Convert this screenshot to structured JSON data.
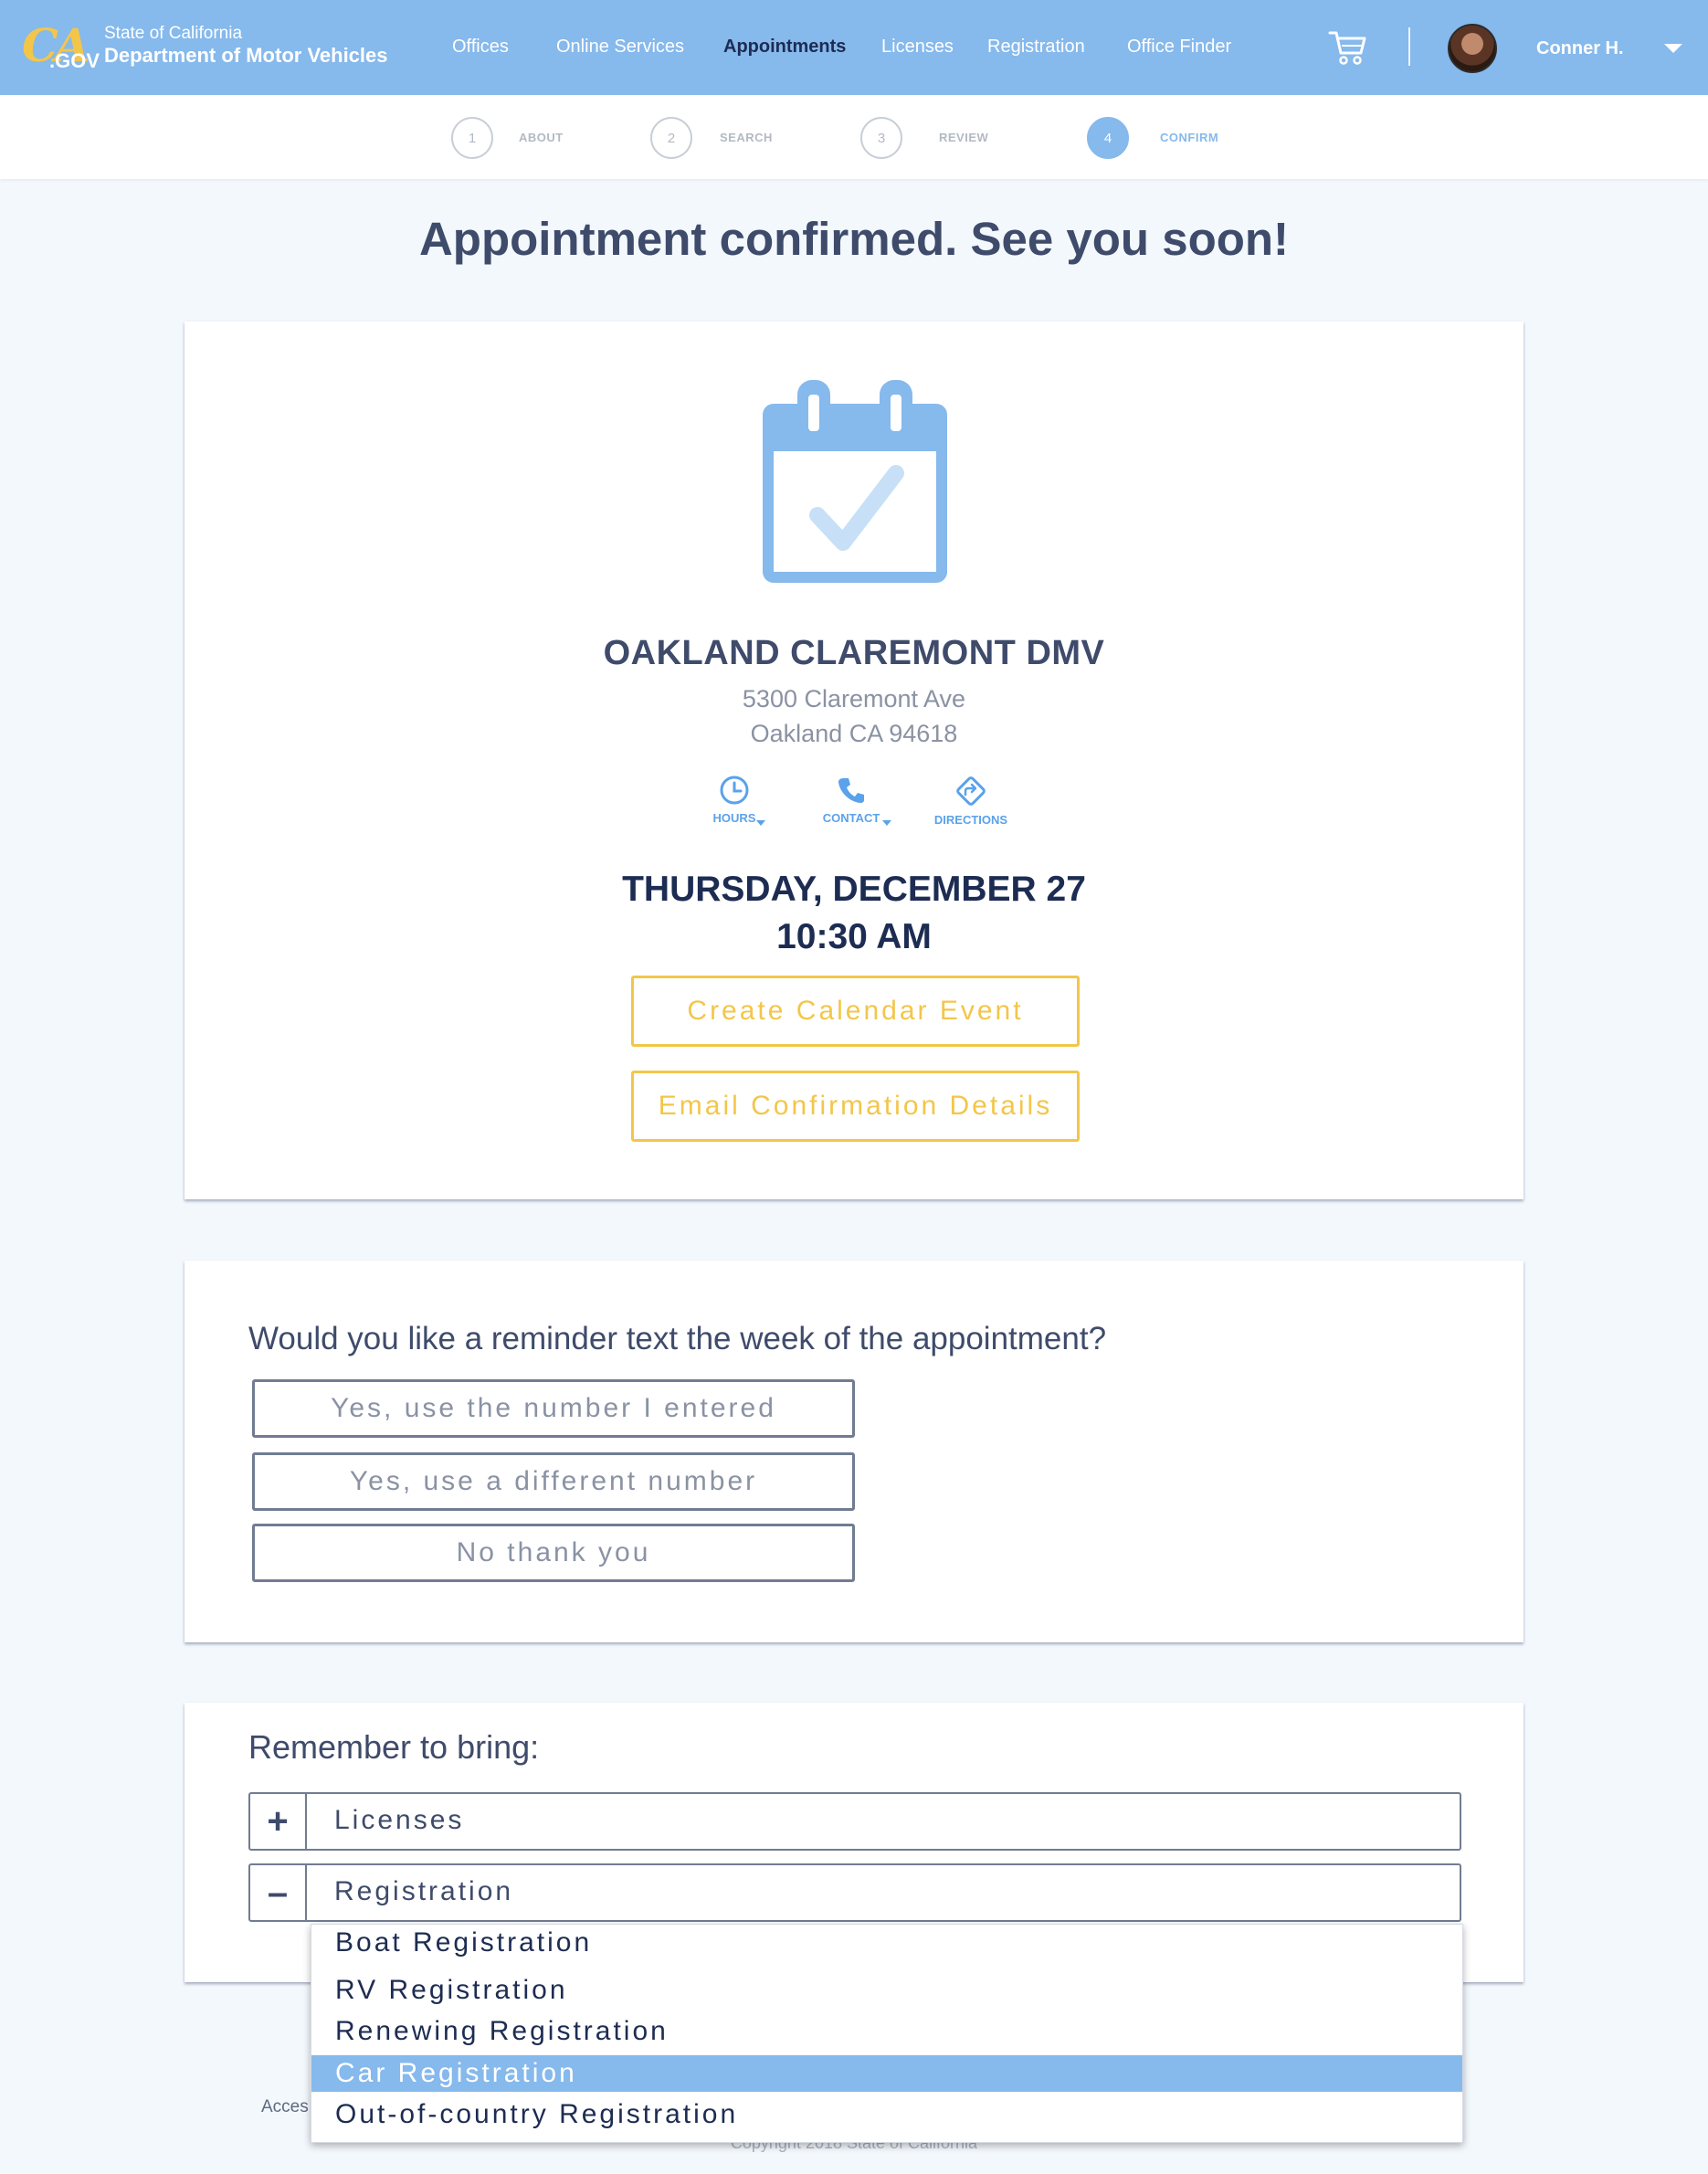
{
  "header": {
    "logo_ca": "CA",
    "logo_gov": ".GOV",
    "agency_top": "State of California",
    "agency_name": "Department of Motor Vehicles",
    "nav": [
      {
        "label": "Offices",
        "active": false
      },
      {
        "label": "Online Services",
        "active": false
      },
      {
        "label": "Appointments",
        "active": true
      },
      {
        "label": "Licenses",
        "active": false
      },
      {
        "label": "Registration",
        "active": false
      },
      {
        "label": "Office Finder",
        "active": false
      }
    ],
    "user_name": "Conner H.",
    "icons": {
      "cart": "cart-icon",
      "caret": "chevron-down-icon"
    }
  },
  "stepper": {
    "steps": [
      {
        "number": "1",
        "label": "ABOUT",
        "done": false
      },
      {
        "number": "2",
        "label": "SEARCH",
        "done": false
      },
      {
        "number": "3",
        "label": "REVIEW",
        "done": false
      },
      {
        "number": "4",
        "label": "CONFIRM",
        "done": true
      }
    ]
  },
  "page_title": "Appointment confirmed. See you soon!",
  "confirmation": {
    "office_name": "OAKLAND CLAREMONT DMV",
    "address_line1": "5300 Claremont Ave",
    "address_line2": "Oakland CA 94618",
    "actions": [
      {
        "label": "HOURS",
        "icon": "clock-icon",
        "has_caret": true
      },
      {
        "label": "CONTACT",
        "icon": "phone-icon",
        "has_caret": true
      },
      {
        "label": "DIRECTIONS",
        "icon": "directions-icon",
        "has_caret": false
      }
    ],
    "date": "THURSDAY, DECEMBER 27",
    "time": "10:30 AM",
    "calendar_button": "Create Calendar Event",
    "email_button": "Email Confirmation Details"
  },
  "reminder": {
    "question": "Would you like a reminder text the week of the appointment?",
    "options": [
      "Yes, use the number I entered",
      "Yes, use a different number",
      "No thank you"
    ]
  },
  "bring": {
    "title": "Remember to bring:",
    "sections": [
      {
        "toggle": "+",
        "label": "Licenses",
        "expanded": false
      },
      {
        "toggle": "–",
        "label": "Registration",
        "expanded": true
      }
    ],
    "dropdown_items": [
      {
        "label": "Boat Registration",
        "selected": false
      },
      {
        "label": "RV Registration",
        "selected": false
      },
      {
        "label": "Renewing Registration",
        "selected": false
      },
      {
        "label": "Car Registration",
        "selected": true
      },
      {
        "label": "Out-of-country Registration",
        "selected": false
      }
    ]
  },
  "footer": {
    "accessibility_fragment": "Acces",
    "copyright": "Copyright 2018 State of California"
  },
  "colors": {
    "header_bg": "#86b9ec",
    "accent_yellow": "#f3c64a",
    "text_dark": "#3f4b6b",
    "text_navy": "#1d2c52",
    "link_blue": "#5aa2ea"
  }
}
